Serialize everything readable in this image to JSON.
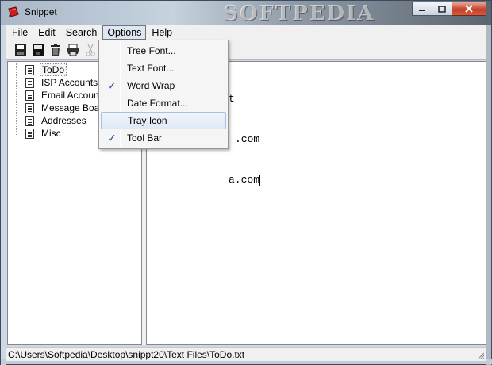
{
  "window": {
    "title": "Snippet",
    "watermark": "SOFTPEDIA"
  },
  "menubar": {
    "items": [
      "File",
      "Edit",
      "Search",
      "Options",
      "Help"
    ],
    "active": "Options"
  },
  "toolbar": {
    "icons": [
      "save-icon",
      "save-all-icon",
      "delete-icon",
      "print-icon",
      "cut-icon"
    ]
  },
  "tree": {
    "items": [
      "ToDo",
      "ISP Accounts",
      "Email Accounts",
      "Message Boards",
      "Addresses",
      "Misc"
    ],
    "selected": "ToDo"
  },
  "editor": {
    "lines": [
      "t",
      ".com",
      "a.com"
    ]
  },
  "options_menu": {
    "items": [
      {
        "label": "Tree Font...",
        "checked": false
      },
      {
        "label": "Text Font...",
        "checked": false
      },
      {
        "label": "Word Wrap",
        "checked": true
      },
      {
        "label": "Date Format...",
        "checked": false
      },
      {
        "label": "Tray Icon",
        "checked": false,
        "hover": true
      },
      {
        "label": "Tool Bar",
        "checked": true
      }
    ]
  },
  "statusbar": {
    "path": "C:\\Users\\Softpedia\\Desktop\\snippt20\\Text Files\\ToDo.txt"
  }
}
